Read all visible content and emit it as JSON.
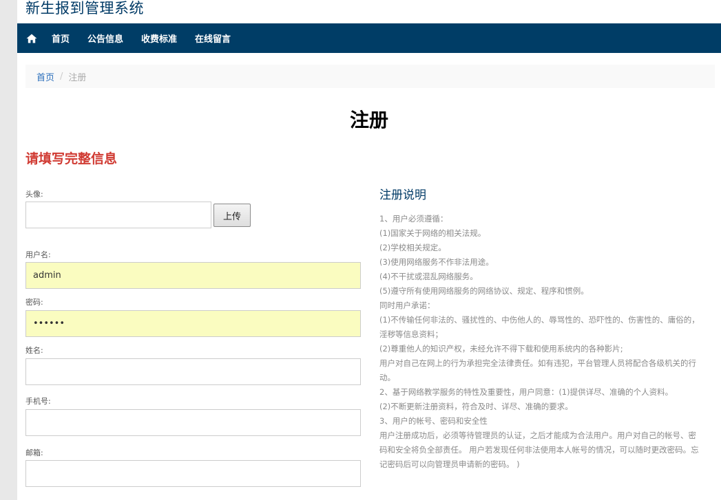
{
  "site": {
    "title": "新生报到管理系统"
  },
  "nav": {
    "items": [
      {
        "label": "首页"
      },
      {
        "label": "公告信息"
      },
      {
        "label": "收费标准"
      },
      {
        "label": "在线留言"
      }
    ]
  },
  "breadcrumb": {
    "home": "首页",
    "separator": "/",
    "current": "注册"
  },
  "page": {
    "title": "注册",
    "notice": "请填写完整信息"
  },
  "form": {
    "avatar": {
      "label": "头像:",
      "value": "",
      "button": "上传"
    },
    "username": {
      "label": "用户名:",
      "value": "admin"
    },
    "password": {
      "label": "密码:",
      "value": "••••••"
    },
    "name": {
      "label": "姓名:",
      "value": ""
    },
    "phone": {
      "label": "手机号:",
      "value": ""
    },
    "email": {
      "label": "邮箱:",
      "value": ""
    }
  },
  "rules": {
    "title": "注册说明",
    "lines": [
      "1、用户必须遵循：",
      "(1)国家关于网络的相关法规。",
      "(2)学校相关规定。",
      "(3)使用网络服务不作非法用途。",
      "(4)不干扰或混乱网络服务。",
      "(5)遵守所有使用网络服务的网络协议、规定、程序和惯例。",
      "同时用户承诺：",
      "(1)不传输任何非法的、骚扰性的、中伤他人的、辱骂性的、恐吓性的、伤害性的、庸俗的，淫秽等信息资料；",
      "(2)尊重他人的知识产权，未经允许不得下载和使用系统内的各种影片;",
      "用户对自己在网上的行为承担完全法律责任。如有违犯，平台管理人员将配合各级机关的行动。",
      "2、基于网络教学服务的特性及重要性，用户同意：(1)提供详尽、准确的个人资料。",
      "(2)不断更新注册资料，符合及时、详尽、准确的要求。",
      "3、用户的帐号、密码和安全性",
      "用户注册成功后，必须等待管理员的认证，之后才能成为合法用户。用户对自己的帐号、密码和安全将负全部责任。 用户若发现任何非法使用本人帐号的情况，可以随时更改密码。忘记密码后可以向管理员申请新的密码。 )"
    ]
  },
  "colors": {
    "navbar_bg": "#003d66",
    "title_color": "#003a66",
    "notice_color": "#d03a32",
    "autofill_bg": "#fafcc0"
  },
  "icons": {
    "nav_home": "home-icon"
  }
}
